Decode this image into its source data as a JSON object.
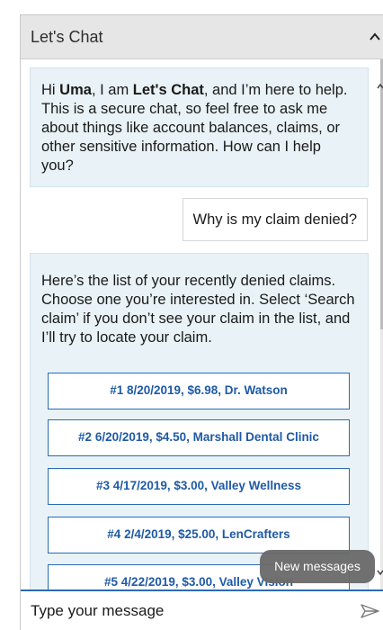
{
  "header": {
    "title": "Let's Chat",
    "collapse_icon": "chevron-up-icon"
  },
  "messages": {
    "greeting": {
      "hi": "Hi ",
      "user_name": "Uma",
      "i_am": ", I am ",
      "bot_name": "Let's Chat",
      "rest": ", and I’m here to help. This is a secure chat, so feel free to ask me about things like account balances, claims, or other sensitive information. How can I help you?"
    },
    "user_question": "Why is my claim denied?",
    "denied_intro": "Here’s the list of your recently denied claims. Choose one you’re interested in. Select ‘Search claim’ if you don’t see your claim in the list, and I’ll try to locate your claim.",
    "claims": [
      "#1 8/20/2019, $6.98, Dr. Watson",
      "#2 6/20/2019, $4.50, Marshall Dental Clinic",
      "#3 4/17/2019, $3.00, Valley Wellness",
      "#4 2/4/2019, $25.00, LenCrafters",
      "#5 4/22/2019, $3.00, Valley Vision"
    ]
  },
  "new_messages_label": "New messages",
  "composer": {
    "placeholder": "Type your message",
    "send_icon": "send-icon"
  },
  "colors": {
    "accent": "#2b6bb5",
    "bot_bubble": "#e9f2f6",
    "header": "#e6e6e6"
  }
}
